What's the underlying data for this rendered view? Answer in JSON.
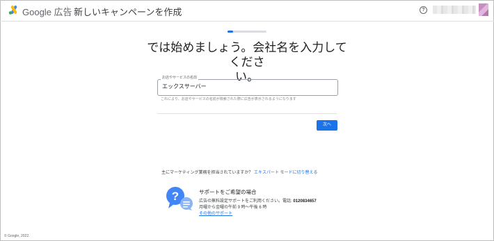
{
  "header": {
    "brand": "Google 広告",
    "campaign_title": "新しいキャンペーンを作成",
    "help_glyph": "?",
    "help_icon": "help-circle-icon",
    "logo_icon": "google-ads-logo-icon"
  },
  "progress": {
    "fraction": 0.15
  },
  "main": {
    "heading_line1": "では始めましょう。会社名を入力してくださ",
    "heading_line2": "い。",
    "field": {
      "label": "お店やサービスの名前",
      "value": "エックスサーバー",
      "helper": "これにより、お店やサービスの名前が検索された際に広告が表示されるようになります"
    },
    "next_label": "次へ"
  },
  "expert": {
    "question": "主にマーケティング業務を担当されていますか？",
    "link": "エキスパート モードに切り替える"
  },
  "support": {
    "icon": "support-chat-icon",
    "title": "サポートをご希望の場合",
    "desc": "広告の無料設定サポートをご利用ください。電話:",
    "phone": "0120834657",
    "hours": "月曜から金曜の午前 9 時〜午後 6 時",
    "link": "その他のサポート"
  },
  "footer": {
    "copyright": "© Google, 2022."
  },
  "colors": {
    "accent": "#1a73e8"
  }
}
